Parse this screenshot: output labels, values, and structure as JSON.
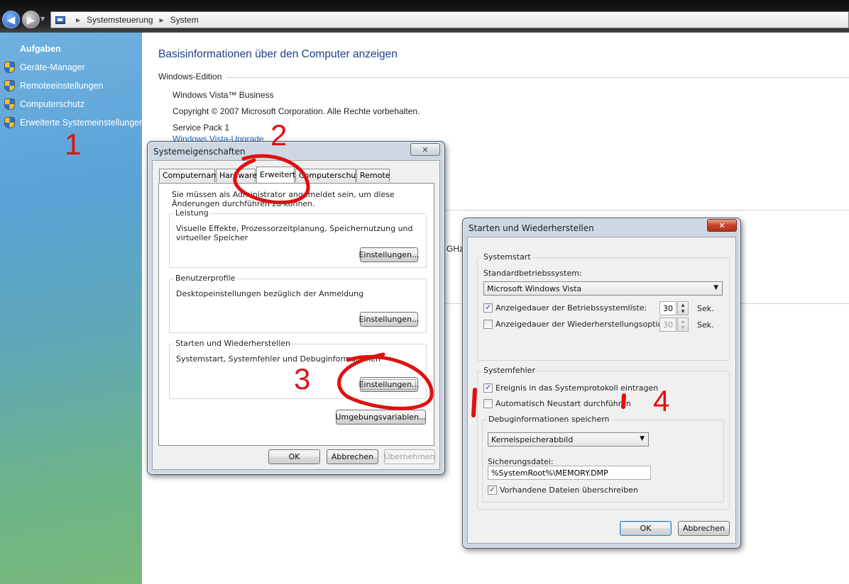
{
  "nav": {
    "back_icon": "back-arrow-icon",
    "forward_icon": "forward-arrow-icon"
  },
  "address": {
    "crumb1": "Systemsteuerung",
    "crumb2": "System"
  },
  "sidebar": {
    "heading": "Aufgaben",
    "items": [
      {
        "label": "Geräte-Manager",
        "icon": "shield-icon"
      },
      {
        "label": "Remoteeinstellungen",
        "icon": "shield-icon"
      },
      {
        "label": "Computerschutz",
        "icon": "shield-icon"
      },
      {
        "label": "Erweiterte Systemeinstellungen",
        "icon": "shield-icon"
      }
    ]
  },
  "main": {
    "title": "Basisinformationen über den Computer anzeigen",
    "edition_heading": "Windows-Edition",
    "edition": "Windows Vista™ Business",
    "copyright": "Copyright © 2007 Microsoft Corporation. Alle Rechte vorbehalten.",
    "service_pack": "Service Pack 1",
    "upgrade_link": "Windows Vista-Upgrade",
    "partial_ghz": "GHz"
  },
  "sysprops": {
    "title": "Systemeigenschaften",
    "close": "✕",
    "tabs": [
      "Computername",
      "Hardware",
      "Erweitert",
      "Computerschutz",
      "Remote"
    ],
    "active_tab": "Erweitert",
    "admin_note": "Sie müssen als Administrator angemeldet sein, um diese Änderungen durchführen zu können.",
    "groups": [
      {
        "title": "Leistung",
        "text": "Visuelle Effekte, Prozessorzeitplanung, Speichernutzung und virtueller Speicher",
        "button": "Einstellungen..."
      },
      {
        "title": "Benutzerprofile",
        "text": "Desktopeinstellungen bezüglich der Anmeldung",
        "button": "Einstellungen..."
      },
      {
        "title": "Starten und Wiederherstellen",
        "text": "Systemstart, Systemfehler und Debuginformationen",
        "button": "Einstellungen..."
      }
    ],
    "env_button": "Umgebungsvariablen...",
    "ok": "OK",
    "cancel": "Abbrechen",
    "apply": "Übernehmen"
  },
  "startup": {
    "title": "Starten und Wiederherstellen",
    "close": "✕",
    "systemstart": {
      "heading": "Systemstart",
      "default_os_label": "Standardbetriebssystem:",
      "default_os": "Microsoft Windows Vista",
      "show_list_label": "Anzeigedauer der Betriebssystemliste:",
      "show_list_checked": true,
      "show_list_value": "30",
      "show_recovery_label": "Anzeigedauer der Wiederherstellungsoptionen:",
      "show_recovery_checked": false,
      "show_recovery_value": "30",
      "unit": "Sek."
    },
    "failure": {
      "heading": "Systemfehler",
      "log_event": "Ereignis in das Systemprotokoll eintragen",
      "log_event_checked": true,
      "auto_restart": "Automatisch Neustart durchführen",
      "auto_restart_checked": false,
      "debug_heading": "Debuginformationen speichern",
      "debug_type": "Kernelspeicherabbild",
      "dump_file_label": "Sicherungsdatei:",
      "dump_file": "%SystemRoot%\\MEMORY.DMP",
      "overwrite": "Vorhandene Dateien überschreiben",
      "overwrite_checked": true
    },
    "ok": "OK",
    "cancel": "Abbrechen"
  },
  "annotations": {
    "n1": "1",
    "n2": "2",
    "n3": "3",
    "n4": "4",
    "color": "#e01010"
  }
}
